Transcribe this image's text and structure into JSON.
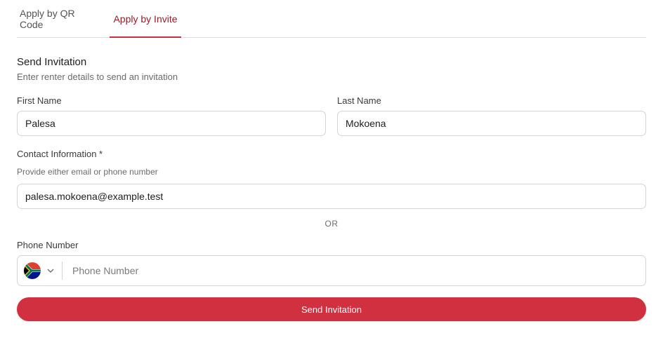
{
  "tabs": [
    {
      "label": "Apply by QR Code",
      "active": false
    },
    {
      "label": "Apply by Invite",
      "active": true
    }
  ],
  "form": {
    "title": "Send Invitation",
    "subtitle": "Enter renter details to send an invitation",
    "first_name": {
      "label": "First Name",
      "value": "Palesa"
    },
    "last_name": {
      "label": "Last Name",
      "value": "Mokoena"
    },
    "contact": {
      "label": "Contact Information *",
      "hint": "Provide either email or phone number",
      "email_value": "palesa.mokoena@example.test"
    },
    "or_label": "OR",
    "phone": {
      "label": "Phone Number",
      "placeholder": "Phone Number",
      "country_flag": "south-africa-flag-icon"
    },
    "submit_label": "Send Invitation"
  },
  "colors": {
    "accent": "#d0303f",
    "active_tab_text": "#9b1b2a",
    "border": "#d4d4d4"
  }
}
